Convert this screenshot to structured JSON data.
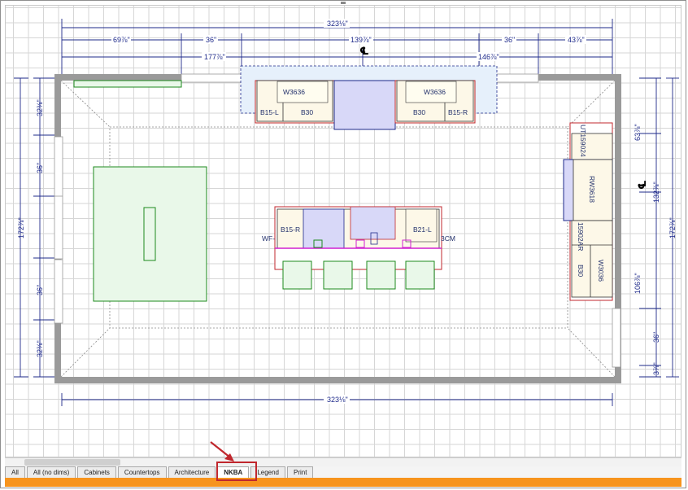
{
  "plan": {
    "dimensions": {
      "overall_width_top": "323⅛\"",
      "seg_69": "69⅞\"",
      "seg_36_left": "36\"",
      "seg_139": "139⅞\"",
      "seg_36_right": "36\"",
      "seg_43": "43⅞\"",
      "seg_177": "177⅞\"",
      "seg_146": "146⅞\"",
      "overall_width_bottom": "323⅛\"",
      "left_total": "172⅞\"",
      "left_32_top": "32⅜\"",
      "left_36_a": "36\"",
      "left_36_b": "36\"",
      "left_32_bottom": "32⅜\"",
      "right_63": "63⅞\"",
      "right_132": "132⅞\"",
      "right_172": "172⅞\"",
      "right_106": "106⅞\"",
      "right_36": "36\"",
      "right_3": "3⅞\""
    },
    "cabinets": {
      "w3636_left": "W3636",
      "w3636_right": "W3636",
      "b15l_top": "B15-L",
      "b30_top_left": "B30",
      "b30_top_right": "B30",
      "b15r_top": "B15-R",
      "b15r_island": "B15-R",
      "b21l_island": "B21-L",
      "wf_label": "WF-",
      "cm_label": "3CM",
      "ut": "UT159024",
      "rw": "RW3618",
      "b_v_ar": "15902AR",
      "b30_right": "B30",
      "w3036": "W3036"
    },
    "centerline_symbol": "℄"
  },
  "tabs": [
    {
      "label": "All",
      "active": false
    },
    {
      "label": "All (no dims)",
      "active": false
    },
    {
      "label": "Cabinets",
      "active": false
    },
    {
      "label": "Countertops",
      "active": false
    },
    {
      "label": "Architecture",
      "active": false
    },
    {
      "label": "NKBA",
      "active": true
    },
    {
      "label": "Legend",
      "active": false
    },
    {
      "label": "Print",
      "active": false
    }
  ],
  "colors": {
    "wall": "#9a9a9a",
    "dimension": "#1e2a8a",
    "cabinet_fill": "#fdf8e8",
    "countertop": "#c0272d",
    "appliance": "#d8d8f8",
    "island_marker": "#d020d0",
    "green_outline": "#1d8a1d",
    "status_bar": "#f7941d",
    "highlight": "#c0272d"
  }
}
